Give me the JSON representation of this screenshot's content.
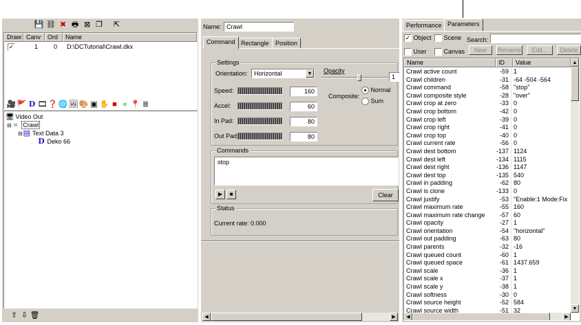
{
  "left_top": {
    "columns": [
      "Draw",
      "Canv",
      "Ord",
      "Name"
    ],
    "rows": [
      {
        "draw": "✓",
        "canv": "1",
        "ord": "0",
        "name": "D:\\DCTutorial\\Crawl.dkx"
      }
    ]
  },
  "tree": {
    "items": [
      {
        "label": "Video Out",
        "icon": "monitor-icon",
        "indent": 0
      },
      {
        "label": "Crawl",
        "icon": "crawl-icon",
        "indent": 1
      },
      {
        "label": "Text Data 3",
        "icon": "text-data-icon",
        "indent": 2
      },
      {
        "label": "Deko 66",
        "icon": "deko-icon",
        "indent": 3
      }
    ]
  },
  "middle": {
    "name_label": "Name:",
    "name_value": "Crawl",
    "tabs": [
      "Command",
      "Rectangle",
      "Position"
    ],
    "settings_title": "Settings",
    "orientation_label": "Orientation:",
    "orientation_value": "Horizontal",
    "opacity_label": "Opacity",
    "opacity_value": "1",
    "speed_label": "Speed:",
    "speed_value": "160",
    "accel_label": "Accel:",
    "accel_value": "60",
    "in_pad_label": "In Pad:",
    "in_pad_value": "80",
    "out_pad_label": "Out Pad:",
    "out_pad_value": "80",
    "composite_label": "Composite:",
    "composite_normal": "Normal",
    "composite_sum": "Sum",
    "commands_title": "Commands",
    "commands_text": "stop",
    "clear_label": "Clear",
    "status_title": "Status",
    "status_text": "Current rate: 0.000"
  },
  "right": {
    "tabs": [
      "Performance",
      "Parameters"
    ],
    "object_label": "Object",
    "scene_label": "Scene",
    "user_label": "User",
    "canvas_label": "Canvas",
    "search_label": "Search:",
    "search_value": "",
    "new_label": "New",
    "rename_label": "Rename",
    "edit_label": "Edit...",
    "delete_label": "Delete",
    "columns": [
      "Name",
      "ID",
      "Value"
    ],
    "params": [
      {
        "name": "Crawl active count",
        "id": "-59",
        "value": "1"
      },
      {
        "name": "Crawl children",
        "id": "-31",
        "value": "-64 -504 -564"
      },
      {
        "name": "Crawl command",
        "id": "-58",
        "value": "\"stop\""
      },
      {
        "name": "Crawl composite style",
        "id": "-28",
        "value": "\"over\""
      },
      {
        "name": "Crawl crop at zero",
        "id": "-33",
        "value": "0"
      },
      {
        "name": "Crawl crop bottom",
        "id": "-42",
        "value": "0"
      },
      {
        "name": "Crawl crop left",
        "id": "-39",
        "value": "0"
      },
      {
        "name": "Crawl crop right",
        "id": "-41",
        "value": "0"
      },
      {
        "name": "Crawl crop top",
        "id": "-40",
        "value": "0"
      },
      {
        "name": "Crawl current rate",
        "id": "-56",
        "value": "0"
      },
      {
        "name": "Crawl dest bottom",
        "id": "-137",
        "value": "1124"
      },
      {
        "name": "Crawl dest left",
        "id": "-134",
        "value": "1115"
      },
      {
        "name": "Crawl dest right",
        "id": "-136",
        "value": "1147"
      },
      {
        "name": "Crawl dest top",
        "id": "-135",
        "value": "540"
      },
      {
        "name": "Crawl in padding",
        "id": "-62",
        "value": "80"
      },
      {
        "name": "Crawl is clone",
        "id": "-133",
        "value": "0"
      },
      {
        "name": "Crawl justify",
        "id": "-53",
        "value": "\"Enable:1 Mode:Fix"
      },
      {
        "name": "Crawl maximum rate",
        "id": "-55",
        "value": "160"
      },
      {
        "name": "Crawl maximum rate change",
        "id": "-57",
        "value": "60"
      },
      {
        "name": "Crawl opacity",
        "id": "-27",
        "value": "1"
      },
      {
        "name": "Crawl orientation",
        "id": "-54",
        "value": "\"horizontal\""
      },
      {
        "name": "Crawl out padding",
        "id": "-63",
        "value": "80"
      },
      {
        "name": "Crawl parents",
        "id": "-32",
        "value": "-16"
      },
      {
        "name": "Crawl queued count",
        "id": "-60",
        "value": "1"
      },
      {
        "name": "Crawl queued space",
        "id": "-61",
        "value": "1437.659"
      },
      {
        "name": "Crawl scale",
        "id": "-36",
        "value": "1"
      },
      {
        "name": "Crawl scale x",
        "id": "-37",
        "value": "1"
      },
      {
        "name": "Crawl scale y",
        "id": "-38",
        "value": "1"
      },
      {
        "name": "Crawl softness",
        "id": "-30",
        "value": "0"
      },
      {
        "name": "Crawl source height",
        "id": "-52",
        "value": "584"
      },
      {
        "name": "Crawl source width",
        "id": "-51",
        "value": "32"
      }
    ]
  },
  "colors": {
    "panel": "#d4d0c8",
    "shadow": "#808080",
    "selection_blue": "#0a246a"
  }
}
